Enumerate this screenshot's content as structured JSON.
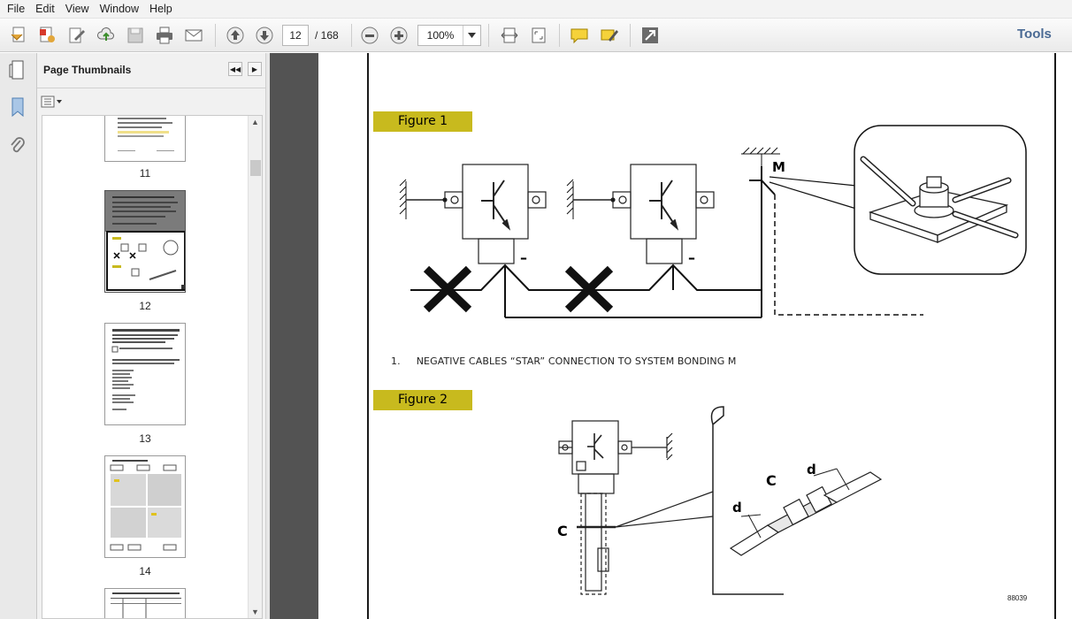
{
  "menu": [
    "File",
    "Edit",
    "View",
    "Window",
    "Help"
  ],
  "toolbar": {
    "current_page": "12",
    "page_total": "/ 168",
    "zoom": "100%",
    "tools_label": "Tools"
  },
  "panel": {
    "title": "Page Thumbnails",
    "thumbnails": [
      {
        "label": "11"
      },
      {
        "label": "12"
      },
      {
        "label": "13"
      },
      {
        "label": "14"
      }
    ]
  },
  "document": {
    "figure1_label": "Figure 1",
    "figure2_label": "Figure 2",
    "caption_number": "1.",
    "caption_text": "NEGATIVE CABLES “STAR” CONNECTION TO SYSTEM BONDING  M",
    "label_m": "M",
    "label_c": "C",
    "label_d": "d",
    "label_minus": "–",
    "ref_code": "88039"
  }
}
